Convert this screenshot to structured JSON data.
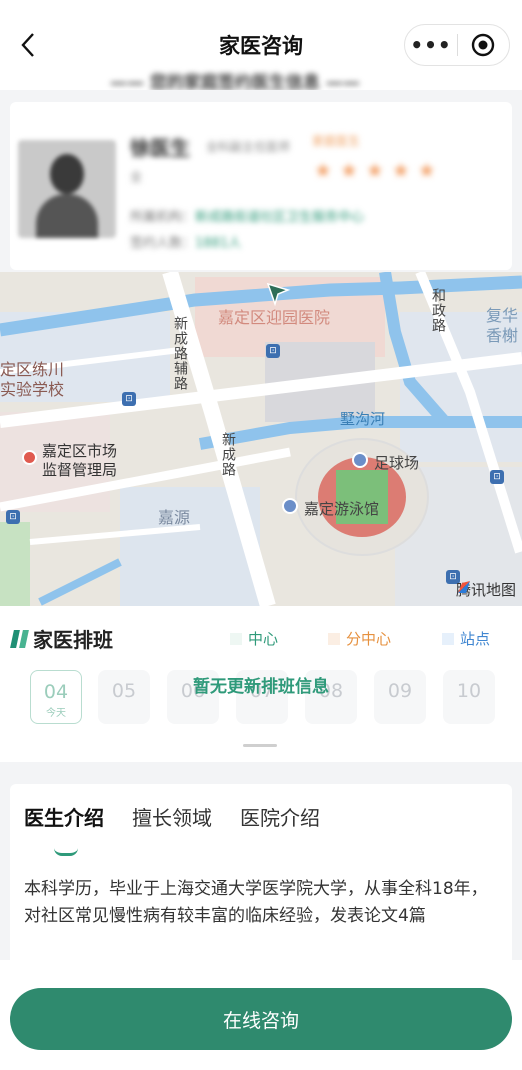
{
  "nav": {
    "title": "家医咨询",
    "more_label": "•••"
  },
  "header_strip": {
    "text": "—— 您的家庭签约医生信息 ——"
  },
  "doctor": {
    "name": "徐医生",
    "title": "全科副主任医师",
    "tag": "家庭医生",
    "sub": "全",
    "rating_stars": 5,
    "institution_label": "所属机构：",
    "institution_value": "新成路街道社区卫生服务中心",
    "signed_label": "签约人数：",
    "signed_value": "1881人"
  },
  "map": {
    "labels": {
      "hospital": "嘉定区迎园医院",
      "road_xincheng_aux": "新成路辅路",
      "road_xincheng": "新成路",
      "road_hezheng": "和政路",
      "school": "定区练川\n实验学校",
      "market": "嘉定区市场\n监督管理局",
      "river": "墅沟河",
      "football": "足球场",
      "swimming": "嘉定游泳馆",
      "jiayuan": "嘉源",
      "fuhua": "复华\n香榭",
      "provider": "腾讯地图"
    }
  },
  "schedule": {
    "title": "家医排班",
    "legend": [
      {
        "label": "中心",
        "color": "#2f9a7a",
        "swatch": "#eef7f3"
      },
      {
        "label": "分中心",
        "color": "#e6913f",
        "swatch": "#fbeee3"
      },
      {
        "label": "站点",
        "color": "#3f86d1",
        "swatch": "#e6f0fb"
      }
    ],
    "dates": [
      {
        "num": "04",
        "sub": "今天"
      },
      {
        "num": "05",
        "sub": ""
      },
      {
        "num": "06",
        "sub": ""
      },
      {
        "num": "07",
        "sub": ""
      },
      {
        "num": "08",
        "sub": ""
      },
      {
        "num": "09",
        "sub": ""
      },
      {
        "num": "10",
        "sub": ""
      }
    ],
    "empty_text": "暂无更新排班信息"
  },
  "intro": {
    "tabs": [
      "医生介绍",
      "擅长领域",
      "医院介绍"
    ],
    "text": "本科学历，毕业于上海交通大学医学院大学，从事全科18年，对社区常见慢性病有较丰富的临床经验，发表论文4篇"
  },
  "consult_button": "在线咨询"
}
